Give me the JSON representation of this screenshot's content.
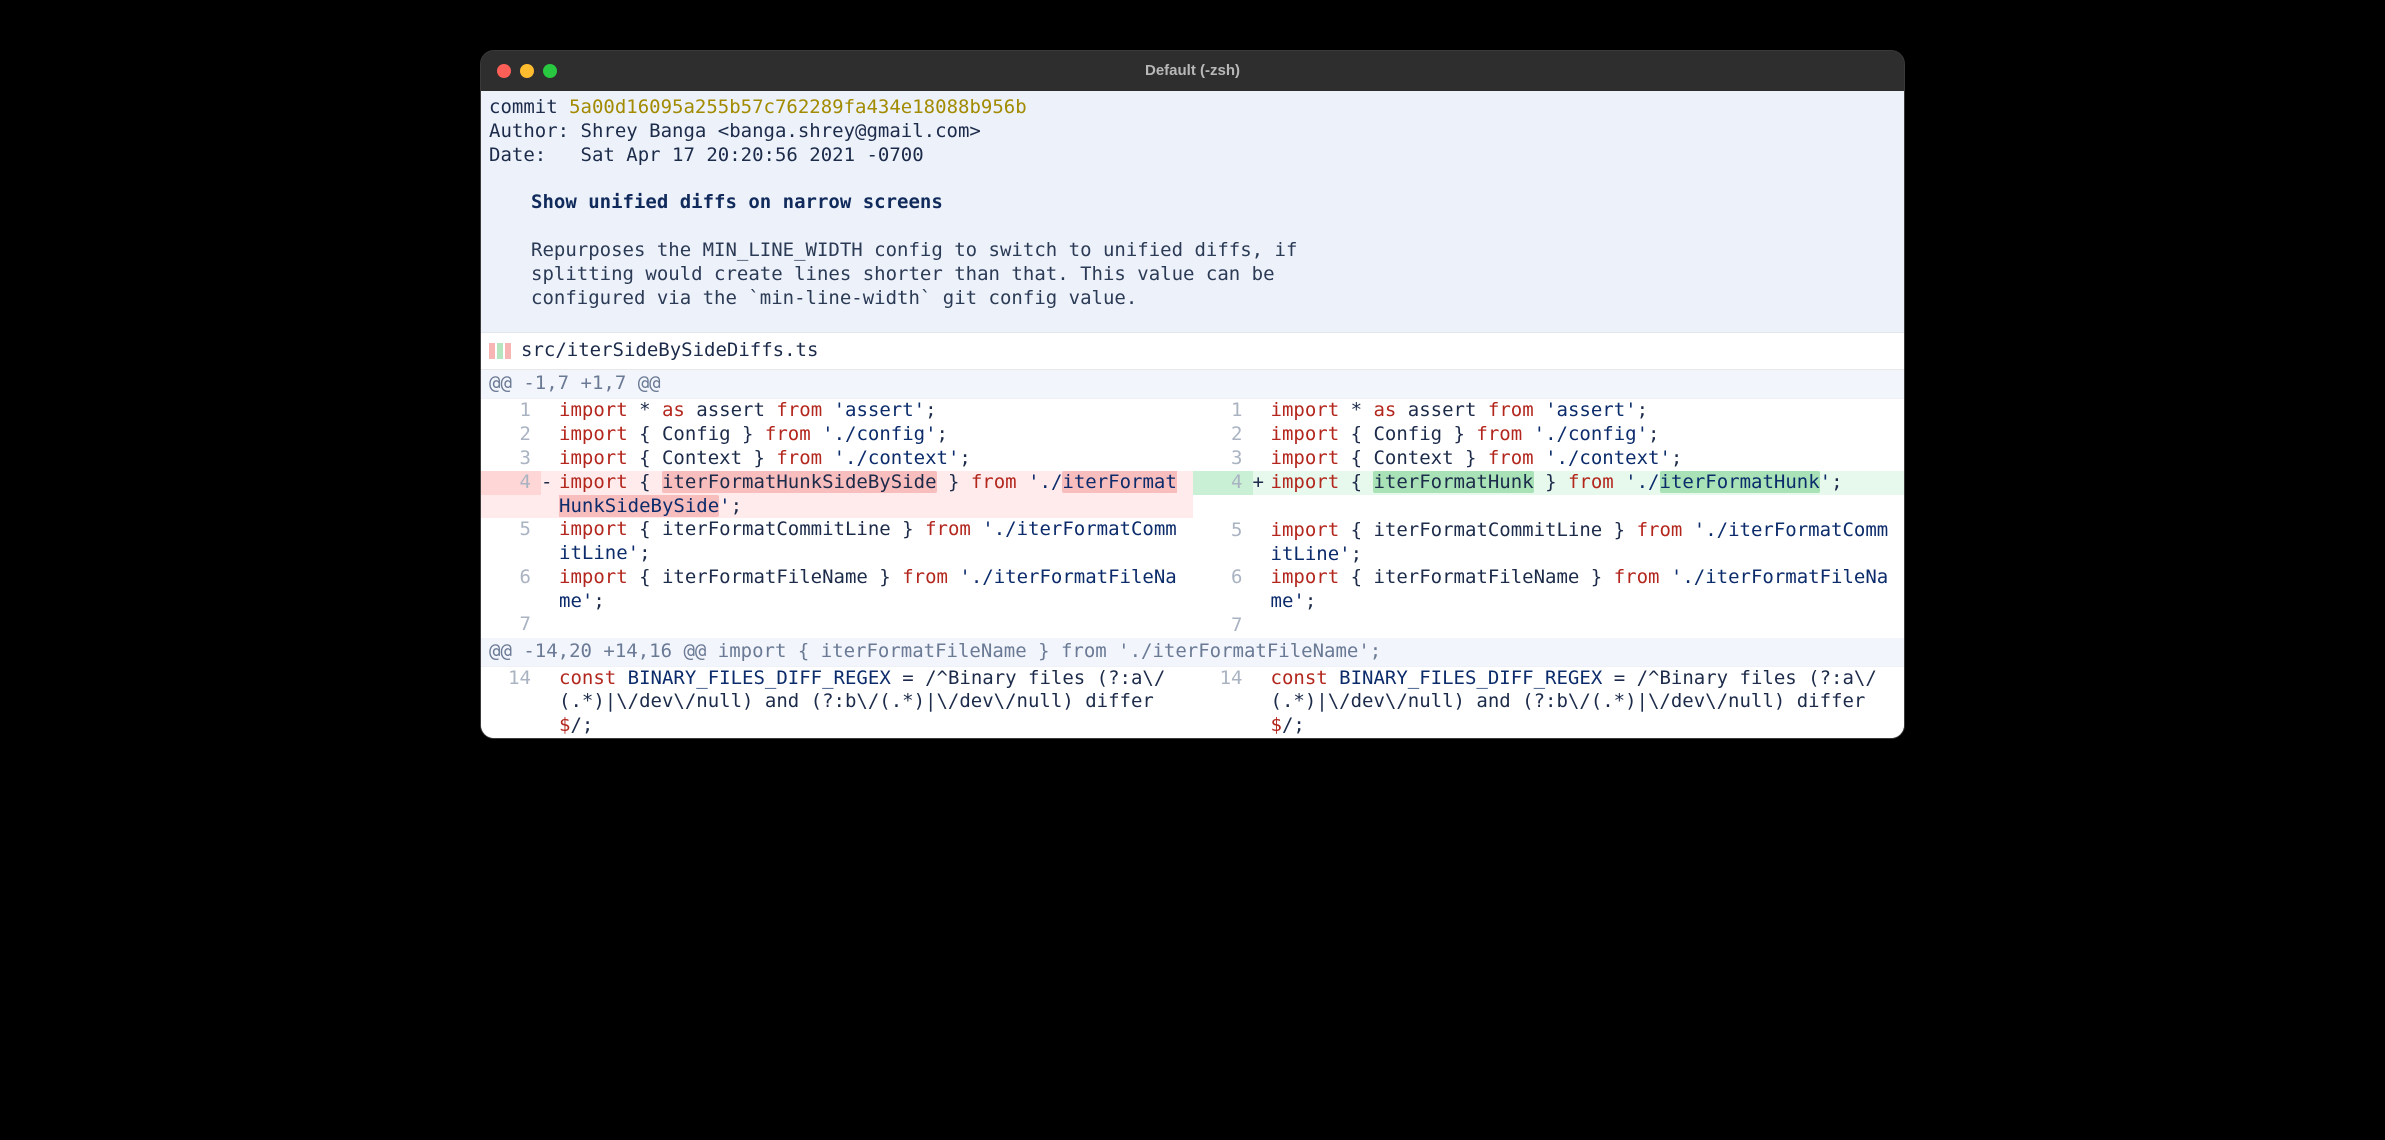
{
  "window": {
    "title": "Default (-zsh)"
  },
  "commit": {
    "hash_label": "commit ",
    "hash": "5a00d16095a255b57c762289fa434e18088b956b",
    "author_line": "Author: Shrey Banga <banga.shrey@gmail.com>",
    "date_line": "Date:   Sat Apr 17 20:20:56 2021 -0700",
    "title": "Show unified diffs on narrow screens",
    "body_l1": "Repurposes the MIN_LINE_WIDTH config to switch to unified diffs, if",
    "body_l2": "splitting would create lines shorter than that. This value can be",
    "body_l3": "configured via the `min-line-width` git config value."
  },
  "file": {
    "path": "src/iterSideBySideDiffs.ts"
  },
  "hunks": [
    {
      "header": "@@ -1,7 +1,7 @@",
      "left": [
        {
          "n": "1",
          "sign": "",
          "tokens": [
            [
              "kw",
              "import"
            ],
            [
              "",
              " * "
            ],
            [
              "kw",
              "as"
            ],
            [
              "",
              " assert "
            ],
            [
              "kw",
              "from"
            ],
            [
              "",
              " "
            ],
            [
              "str",
              "'assert'"
            ],
            [
              "",
              ";"
            ]
          ]
        },
        {
          "n": "2",
          "sign": "",
          "tokens": [
            [
              "kw",
              "import"
            ],
            [
              "",
              " { Config } "
            ],
            [
              "kw",
              "from"
            ],
            [
              "",
              " "
            ],
            [
              "str",
              "'./config'"
            ],
            [
              "",
              ";"
            ]
          ]
        },
        {
          "n": "3",
          "sign": "",
          "tokens": [
            [
              "kw",
              "import"
            ],
            [
              "",
              " { Context } "
            ],
            [
              "kw",
              "from"
            ],
            [
              "",
              " "
            ],
            [
              "str",
              "'./context'"
            ],
            [
              "",
              ";"
            ]
          ]
        },
        {
          "n": "4",
          "sign": "-",
          "kind": "del",
          "tokens": [
            [
              "kw",
              "import"
            ],
            [
              "",
              " { "
            ],
            [
              "hl-del",
              "iterFormatHunkSideBySide"
            ],
            [
              "",
              " } "
            ],
            [
              "kw",
              "from"
            ],
            [
              "",
              " "
            ],
            [
              "str",
              "'./"
            ],
            [
              "hl-del str",
              "iterFormatHunkSideBySide"
            ],
            [
              "str",
              "'"
            ],
            [
              "",
              ";"
            ]
          ]
        },
        {
          "n": "5",
          "sign": "",
          "tokens": [
            [
              "kw",
              "import"
            ],
            [
              "",
              " { iterFormatCommitLine } "
            ],
            [
              "kw",
              "from"
            ],
            [
              "",
              " "
            ],
            [
              "str",
              "'./iterFormatCommitLine'"
            ],
            [
              "",
              ";"
            ]
          ]
        },
        {
          "n": "6",
          "sign": "",
          "tokens": [
            [
              "kw",
              "import"
            ],
            [
              "",
              " { iterFormatFileName } "
            ],
            [
              "kw",
              "from"
            ],
            [
              "",
              " "
            ],
            [
              "str",
              "'./iterFormatFileName'"
            ],
            [
              "",
              ";"
            ]
          ]
        },
        {
          "n": "7",
          "sign": "",
          "tokens": []
        }
      ],
      "right": [
        {
          "n": "1",
          "sign": "",
          "tokens": [
            [
              "kw",
              "import"
            ],
            [
              "",
              " * "
            ],
            [
              "kw",
              "as"
            ],
            [
              "",
              " assert "
            ],
            [
              "kw",
              "from"
            ],
            [
              "",
              " "
            ],
            [
              "str",
              "'assert'"
            ],
            [
              "",
              ";"
            ]
          ]
        },
        {
          "n": "2",
          "sign": "",
          "tokens": [
            [
              "kw",
              "import"
            ],
            [
              "",
              " { Config } "
            ],
            [
              "kw",
              "from"
            ],
            [
              "",
              " "
            ],
            [
              "str",
              "'./config'"
            ],
            [
              "",
              ";"
            ]
          ]
        },
        {
          "n": "3",
          "sign": "",
          "tokens": [
            [
              "kw",
              "import"
            ],
            [
              "",
              " { Context } "
            ],
            [
              "kw",
              "from"
            ],
            [
              "",
              " "
            ],
            [
              "str",
              "'./context'"
            ],
            [
              "",
              ";"
            ]
          ]
        },
        {
          "n": "4",
          "sign": "+",
          "kind": "add",
          "tokens": [
            [
              "kw",
              "import"
            ],
            [
              "",
              " { "
            ],
            [
              "hl-add",
              "iterFormatHunk"
            ],
            [
              "",
              " } "
            ],
            [
              "kw",
              "from"
            ],
            [
              "",
              " "
            ],
            [
              "str",
              "'./"
            ],
            [
              "hl-add str",
              "iterFormatHunk"
            ],
            [
              "str",
              "'"
            ],
            [
              "",
              ";"
            ]
          ]
        },
        {
          "n": "",
          "sign": "",
          "tokens": []
        },
        {
          "n": "5",
          "sign": "",
          "tokens": [
            [
              "kw",
              "import"
            ],
            [
              "",
              " { iterFormatCommitLine } "
            ],
            [
              "kw",
              "from"
            ],
            [
              "",
              " "
            ],
            [
              "str",
              "'./iterFormatCommitLine'"
            ],
            [
              "",
              ";"
            ]
          ]
        },
        {
          "n": "6",
          "sign": "",
          "tokens": [
            [
              "kw",
              "import"
            ],
            [
              "",
              " { iterFormatFileName } "
            ],
            [
              "kw",
              "from"
            ],
            [
              "",
              " "
            ],
            [
              "str",
              "'./iterFormatFileName'"
            ],
            [
              "",
              ";"
            ]
          ]
        },
        {
          "n": "7",
          "sign": "",
          "tokens": []
        }
      ]
    },
    {
      "header": "@@ -14,20 +14,16 @@ import { iterFormatFileName } from './iterFormatFileName';",
      "left": [
        {
          "n": "14",
          "sign": "",
          "tokens": [
            [
              "kw",
              "const"
            ],
            [
              "",
              " "
            ],
            [
              "const-name",
              "BINARY_FILES_DIFF_REGEX"
            ],
            [
              "",
              " = /^Binary files (?:a\\/(.*)|\\/dev\\/null) and (?:b\\/(.*)|\\/dev\\/null) differ"
            ],
            [
              "regex-end",
              "$"
            ],
            [
              "",
              "/;"
            ]
          ]
        }
      ],
      "right": [
        {
          "n": "14",
          "sign": "",
          "tokens": [
            [
              "kw",
              "const"
            ],
            [
              "",
              " "
            ],
            [
              "const-name",
              "BINARY_FILES_DIFF_REGEX"
            ],
            [
              "",
              " = /^Binary files (?:a\\/(.*)|\\/dev\\/null) and (?:b\\/(.*)|\\/dev\\/null) differ"
            ],
            [
              "regex-end",
              "$"
            ],
            [
              "",
              "/;"
            ]
          ]
        }
      ]
    }
  ]
}
